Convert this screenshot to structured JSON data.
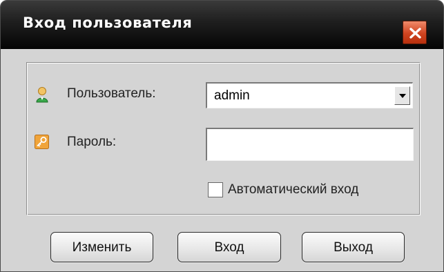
{
  "window": {
    "title": "Вход пользователя",
    "close_icon": "close-icon"
  },
  "form": {
    "user_label": "Пользователь:",
    "user_icon": "user-icon",
    "user_value": "admin",
    "password_label": "Пароль:",
    "password_icon": "key-icon",
    "password_value": "",
    "auto_login_label": "Автоматический вход",
    "auto_login_checked": false
  },
  "buttons": {
    "change_label": "Изменить",
    "login_label": "Вход",
    "exit_label": "Выход"
  },
  "colors": {
    "titlebar": "#111111",
    "dialog_bg": "#d4d4d4",
    "close_button": "#d04420"
  }
}
